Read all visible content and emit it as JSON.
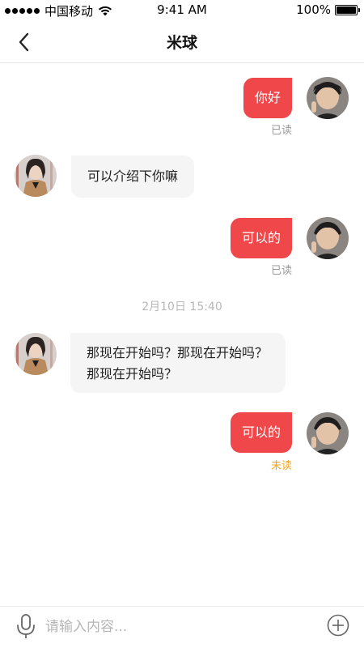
{
  "status_bar": {
    "carrier": "中国移动",
    "time": "9:41 AM",
    "battery": "100%",
    "battery_level": 1.0,
    "signal_icon": "signal-dots-icon",
    "wifi_icon": "wifi-icon",
    "battery_icon": "battery-icon"
  },
  "nav": {
    "title": "米球",
    "back_icon": "chevron-left-icon"
  },
  "messages": [
    {
      "direction": "out",
      "text": "你好",
      "status": "已读"
    },
    {
      "direction": "in",
      "text": "可以介绍下你嘛"
    },
    {
      "direction": "out",
      "text": "可以的",
      "status": "已读"
    },
    {
      "direction": "in",
      "lines": [
        "那现在开始吗？那现在开始吗？",
        "那现在开始吗？"
      ]
    },
    {
      "direction": "out",
      "text": "可以的",
      "status": "未读"
    }
  ],
  "timestamp": "2月10日 15:40",
  "input_bar": {
    "placeholder": "请输入内容...",
    "value": "",
    "mic_icon": "microphone-icon",
    "plus_icon": "plus-circle-icon"
  },
  "colors": {
    "outgoing_bubble": "#f0484a",
    "incoming_bubble": "#f5f5f5",
    "read_status": "#9a9a9a",
    "unread_status": "#f5a623",
    "timestamp": "#b8b8b8"
  }
}
